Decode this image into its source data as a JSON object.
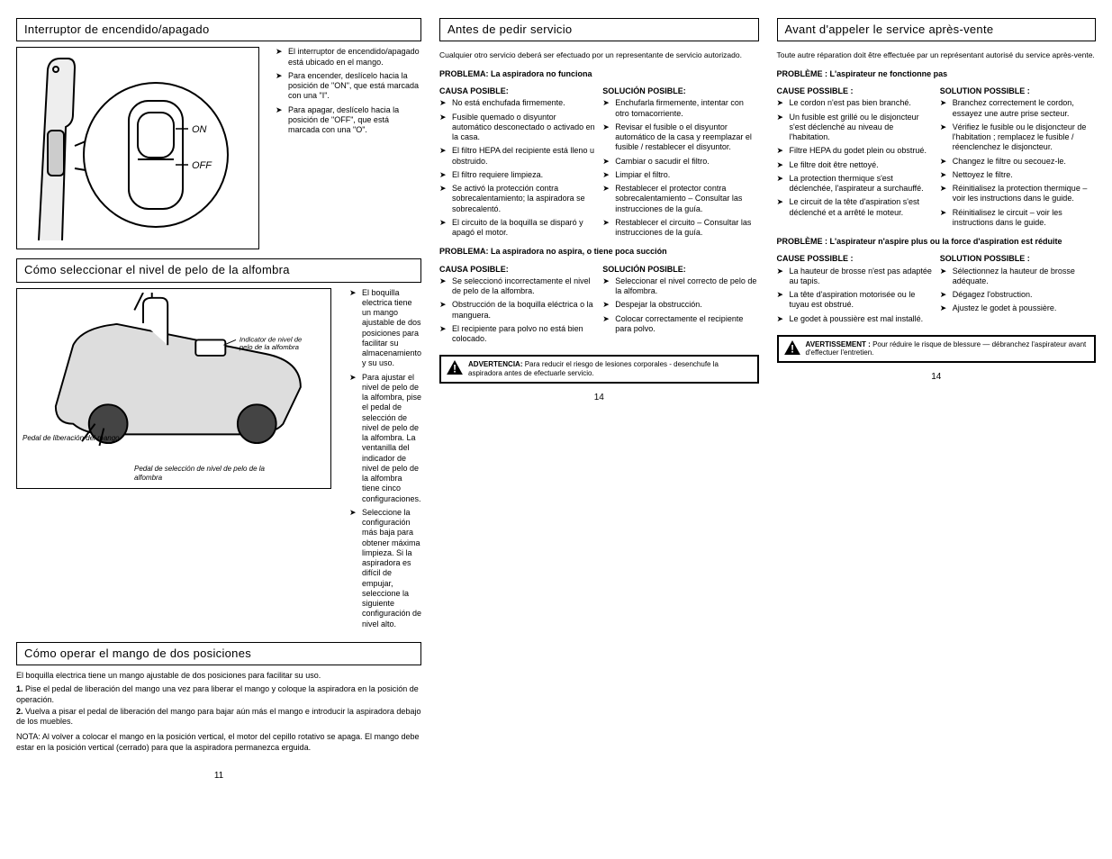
{
  "leftcol": {
    "switch_title": "Interruptor de encendido/apagado",
    "switch_bullets": [
      "El interruptor de encendido/apagado está ubicado en el mango.",
      "Para encender, deslícelo hacia la posición de \"ON\", que está marcada con una \"I\".",
      "Para apagar, deslícelo hacia la posición de \"OFF\", que está marcada con una \"O\"."
    ],
    "on_label": "ON",
    "off_label": "OFF",
    "adjust_title": "Cómo seleccionar el nivel de pelo de la alfombra",
    "adjust_bullets": [
      "El boquilla electrica tiene un mango ajustable de dos posiciones para facilitar su almacenamiento y su uso.",
      "Para ajustar el nivel de pelo de la alfombra, pise el pedal de selección de nivel de pelo de la alfombra. La ventanilla del indicador de nivel de pelo de la alfombra tiene cinco configuraciones.",
      "Seleccione la configuración más baja para obtener máxima limpieza. Si la aspiradora es difícil de empujar, seleccione la siguiente configuración de nivel alto."
    ],
    "fig2_label_indicator": "Indicator de nivel de pelo de la alfombra",
    "fig2_label_pedal1": "Pedal de liberación del mango",
    "fig2_label_pedal2": "Pedal de selección de nivel de pelo de la alfombra",
    "position_title": "Cómo operar el mango de dos posiciones",
    "position_sub": "El boquilla electrica tiene un mango ajustable de dos posiciones para facilitar su uso.",
    "step1": "Pise el pedal de liberación del mango una vez para liberar el mango y coloque la aspiradora en la posición de operación.",
    "step2": "Vuelva a pisar el pedal de liberación del mango para bajar aún más el mango e introducir la aspiradora debajo de los muebles.",
    "pos_note": "NOTA: Al volver a colocar el mango en la posición vertical, el motor del cepillo rotativo se apaga. El mango debe estar en la posición vertical (cerrado) para que la aspiradora permanezca erguida.",
    "pgnum": "11"
  },
  "midcol": {
    "title": "Antes de pedir servicio",
    "intro1": "Cualquier otro servicio deberá ser efectuado por un representante de servicio autorizado.",
    "p1_head": "PROBLEMA: La aspiradora no funciona",
    "p1_cause": "CAUSA POSIBLE:",
    "p1_sol": "SOLUCIÓN POSIBLE:",
    "p1_c": [
      "No está enchufada firmemente.",
      "Fusible quemado o disyuntor automático desconectado o activado en la casa.",
      "El filtro HEPA del recipiente está lleno u obstruido.",
      "El filtro requiere limpieza.",
      "Se activó la protección contra sobrecalentamiento; la aspiradora se sobrecalentó.",
      "El circuito de la boquilla se disparó y apagó el motor."
    ],
    "p1_s": [
      "Enchufarla firmemente, intentar con otro tomacorriente.",
      "Revisar el fusible o el disyuntor automático de la casa y reemplazar el fusible / restablecer el disyuntor.",
      "Cambiar o sacudir el filtro.",
      "Limpiar el filtro.",
      "Restablecer el protector contra sobrecalentamiento – Consultar las instrucciones de la guía.",
      "Restablecer el circuito – Consultar las instrucciones de la guía."
    ],
    "p2_head": "PROBLEMA: La aspiradora no aspira, o tiene poca succión",
    "p2_c": [
      "Se seleccionó incorrectamente el nivel de pelo de la alfombra.",
      "Obstrucción de la boquilla eléctrica o la manguera.",
      "El recipiente para polvo no está bien colocado."
    ],
    "p2_s": [
      "Seleccionar el nivel correcto de pelo de la alfombra.",
      "Despejar la obstrucción.",
      "Colocar correctamente el recipiente para polvo."
    ],
    "warn_title": "ADVERTENCIA:",
    "warn_body": "Para reducir el riesgo de lesiones corporales - desenchufe la aspiradora antes de efectuarle servicio.",
    "pgnum": "14"
  },
  "rightcol": {
    "title": "Avant d'appeler le service après-vente",
    "intro1": "Toute autre réparation doit être effectuée par un représentant autorisé du service après-vente.",
    "p1_head": "PROBLÈME : L'aspirateur ne fonctionne pas",
    "p1_cause": "CAUSE POSSIBLE :",
    "p1_sol": "SOLUTION POSSIBLE :",
    "p1_c": [
      "Le cordon n'est pas bien branché.",
      "Un fusible est grillé ou le disjoncteur s'est déclenché au niveau de l'habitation.",
      "Filtre HEPA du godet plein ou obstrué.",
      "Le filtre doit être nettoyé.",
      "La protection thermique s'est déclenchée, l'aspirateur a surchauffé.",
      "Le circuit de la tête d'aspiration s'est déclenché et a arrêté le moteur."
    ],
    "p1_s": [
      "Branchez correctement le cordon, essayez une autre prise secteur.",
      "Vérifiez le fusible ou le disjoncteur de l'habitation ; remplacez le fusible / réenclenchez le disjoncteur.",
      "Changez le filtre ou secouez-le.",
      "Nettoyez le filtre.",
      "Réinitialisez la protection thermique – voir les instructions dans le guide.",
      "Réinitialisez le circuit – voir les instructions dans le guide."
    ],
    "p2_head": "PROBLÈME : L'aspirateur n'aspire plus ou la force d'aspiration est réduite",
    "p2_c": [
      "La hauteur de brosse n'est pas adaptée au tapis.",
      "La tête d'aspiration motorisée ou le tuyau est obstrué.",
      "Le godet à poussière est mal installé."
    ],
    "p2_s": [
      "Sélectionnez la hauteur de brosse adéquate.",
      "Dégagez l'obstruction.",
      "Ajustez le godet à poussière."
    ],
    "warn_title": "AVERTISSEMENT :",
    "warn_body": "Pour réduire le risque de blessure — débranchez l'aspirateur avant d'effectuer l'entretien.",
    "pgnum": "14"
  }
}
